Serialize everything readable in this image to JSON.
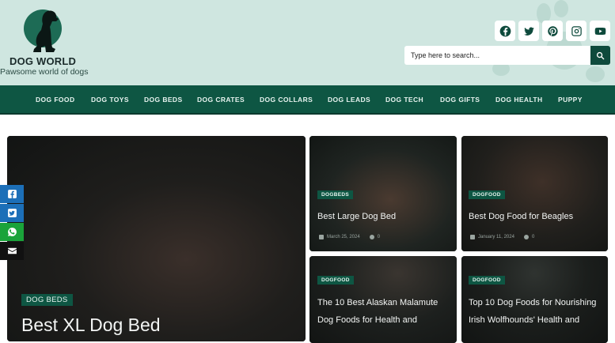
{
  "brand": {
    "title": "DOG WORLD",
    "tagline": "Pawsome world of dogs"
  },
  "social": [
    "facebook-icon",
    "twitter-icon",
    "pinterest-icon",
    "instagram-icon",
    "youtube-icon"
  ],
  "search": {
    "placeholder": "Type here to search..."
  },
  "nav": {
    "items": [
      "DOG FOOD",
      "DOG TOYS",
      "DOG BEDS",
      "DOG CRATES",
      "DOG COLLARS",
      "DOG LEADS",
      "DOG TECH",
      "DOG GIFTS",
      "DOG HEALTH",
      "PUPPY"
    ]
  },
  "share": [
    "facebook-icon",
    "twitter-icon",
    "whatsapp-icon",
    "email-icon"
  ],
  "featured": {
    "category": "DOG BEDS",
    "title": "Best XL Dog Bed"
  },
  "posts": [
    {
      "category": "DOGBEDS",
      "title": "Best Large Dog Bed",
      "date": "March 25, 2024",
      "comments": "0"
    },
    {
      "category": "DOGFOOD",
      "title": "Best Dog Food for Beagles",
      "date": "January 11, 2024",
      "comments": "0"
    },
    {
      "category": "DOGFOOD",
      "title": "The 10 Best Alaskan Malamute Dog Foods for Health and"
    },
    {
      "category": "DOGFOOD",
      "title": "Top 10 Dog Foods for Nourishing Irish Wolfhounds' Health and"
    }
  ],
  "colors": {
    "header_bg": "#cfe6e0",
    "nav_bg": "#0e5643",
    "brand_dark": "#0e4a3c",
    "share_blue": "#1c6fb8",
    "share_green": "#1aa33a",
    "share_dark": "#111111"
  }
}
